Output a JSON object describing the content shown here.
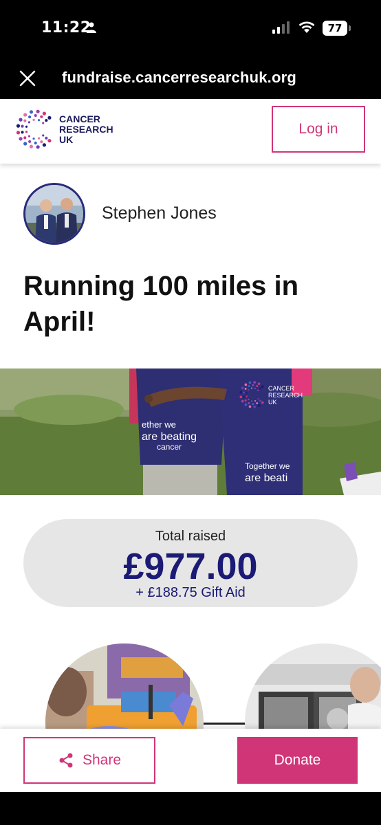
{
  "status_bar": {
    "time": "11:22",
    "battery": "77"
  },
  "browser": {
    "url": "fundraise.cancerresearchuk.org"
  },
  "header": {
    "logo_lines": [
      "CANCER",
      "RESEARCH",
      "UK"
    ],
    "login_label": "Log in"
  },
  "fundraiser": {
    "name": "Stephen Jones",
    "title": "Running 100 miles in April!"
  },
  "hero": {
    "vest_text_left": [
      "ether we",
      "are beating",
      "cancer"
    ],
    "vest_text_right": [
      "Together we",
      "are beati"
    ],
    "vest_logo_lines": [
      "CANCER",
      "RESEARCH",
      "UK"
    ]
  },
  "totals": {
    "label": "Total raised",
    "amount": "£977.00",
    "gift_aid": "+ £188.75 Gift Aid"
  },
  "actions": {
    "share_label": "Share",
    "donate_label": "Donate"
  },
  "colors": {
    "brand_pink": "#d03578",
    "brand_navy": "#1b1a75"
  }
}
